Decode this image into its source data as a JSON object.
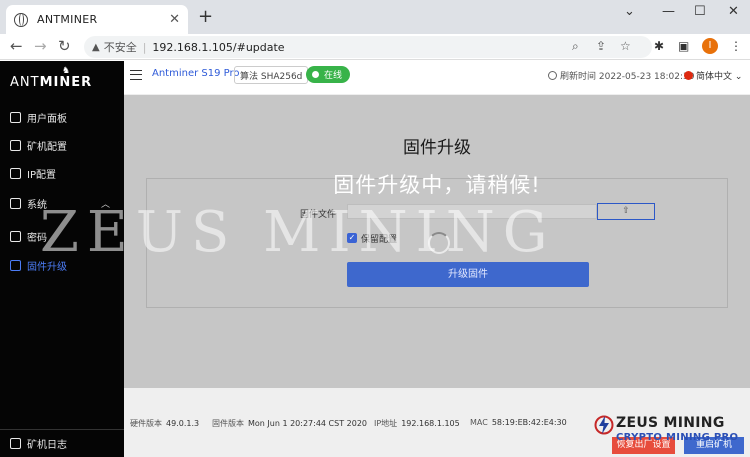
{
  "browser": {
    "tab_title": "ANTMINER",
    "tab_close": "✕",
    "new_tab": "+",
    "security_label": "不安全",
    "url": "192.168.1.105/#update",
    "profile_initial": "I"
  },
  "sidebar": {
    "logo_ant": "ANT",
    "logo_miner": "MINER",
    "items": [
      {
        "label": "用户面板"
      },
      {
        "label": "矿机配置"
      },
      {
        "label": "IP配置"
      },
      {
        "label": "系统"
      },
      {
        "label": "密码"
      },
      {
        "label": "固件升级"
      }
    ],
    "bottom_label": "矿机日志"
  },
  "header": {
    "model": "Antminer S19 Pro",
    "algorithm": "算法 SHA256d",
    "status": "在线",
    "refresh_label": "刷新时间",
    "refresh_time": "2022-05-23 18:02:30",
    "language": "简体中文"
  },
  "main": {
    "title": "固件升级",
    "overlay_message": "固件升级中，请稍候!",
    "file_label": "固件文件",
    "keep_settings_label": "保留配置",
    "submit_label": "升级固件"
  },
  "footer": {
    "hardware_label": "硬件版本",
    "hardware_value": "49.0.1.3",
    "firmware_label": "固件版本",
    "firmware_value": "Mon Jun 1 20:27:44 CST 2020",
    "ip_label": "IP地址",
    "ip_value": "192.168.1.105",
    "mac_label": "MAC",
    "mac_value": "58:19:EB:42:E4:30",
    "reset_button": "恢复出厂设置",
    "reboot_button": "重启矿机"
  },
  "watermark": {
    "text": "ZEUS MINING",
    "brand_line1": "ZEUS MINING",
    "brand_line2": "CRYPTO MINING PRO"
  }
}
